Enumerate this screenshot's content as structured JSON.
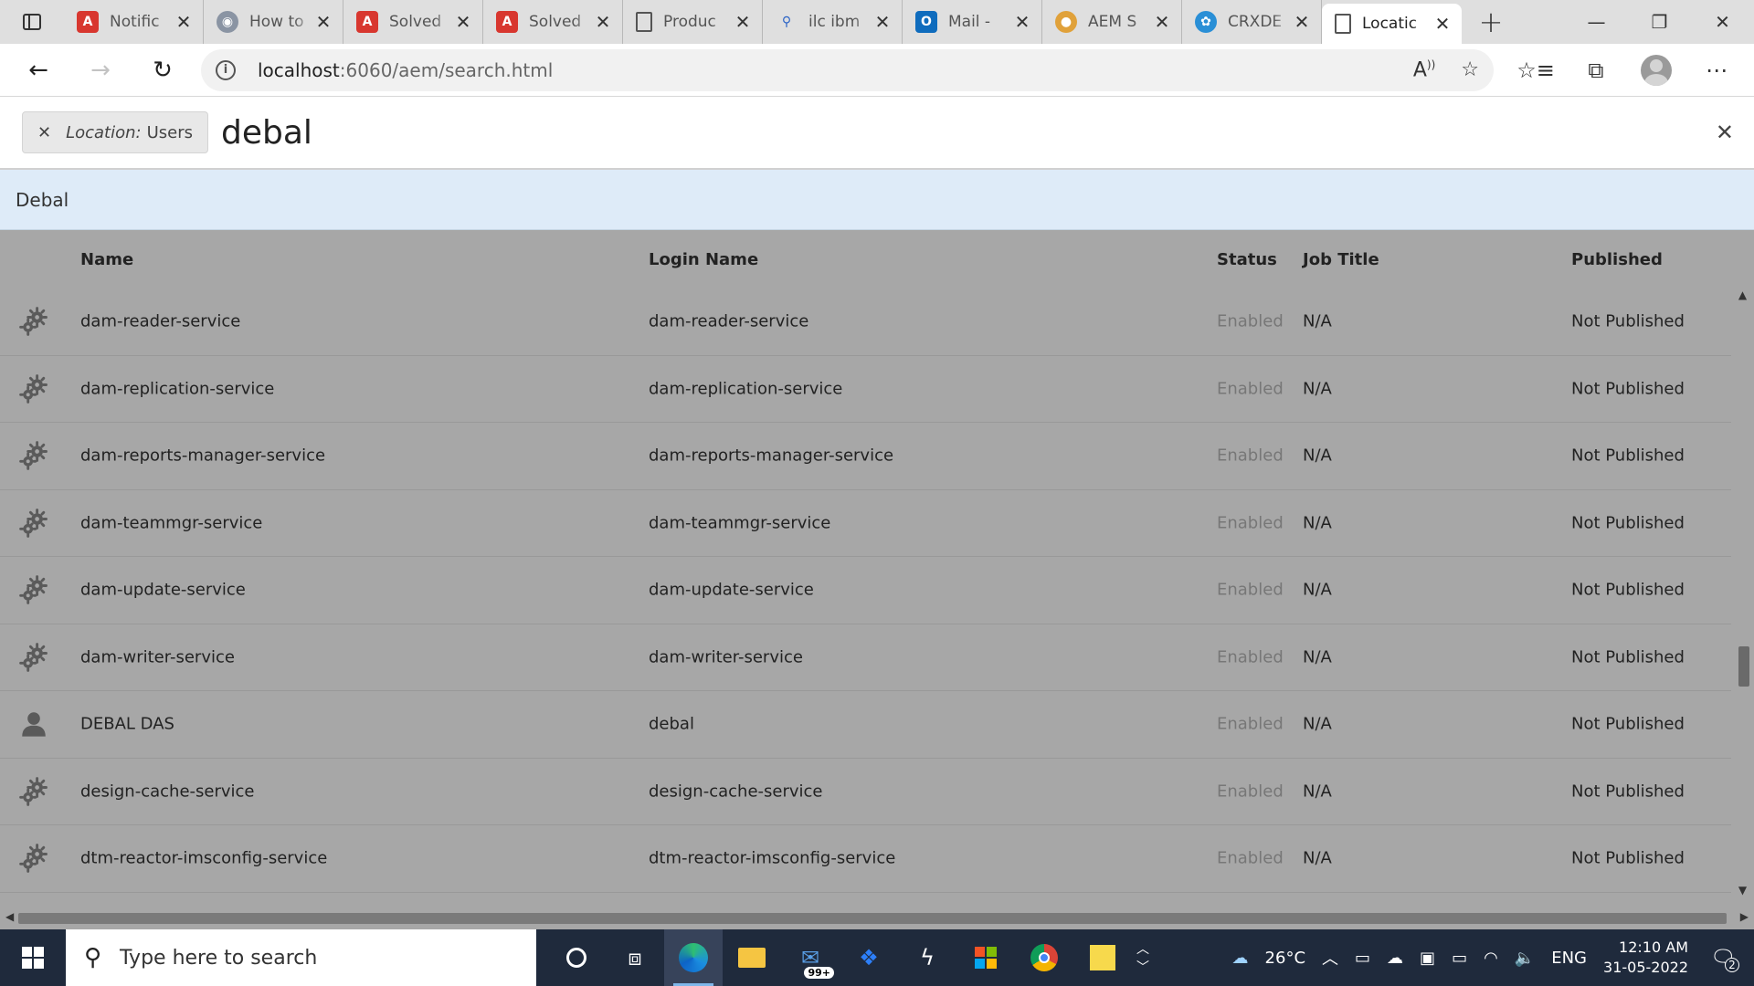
{
  "browser": {
    "tabs": [
      {
        "title": "Notific",
        "icon": "adobe-icon",
        "active": false
      },
      {
        "title": "How to",
        "icon": "globe-icon",
        "active": false
      },
      {
        "title": "Solved",
        "icon": "adobe-icon",
        "active": false
      },
      {
        "title": "Solved",
        "icon": "adobe-icon",
        "active": false
      },
      {
        "title": "Produc",
        "icon": "page-icon",
        "active": false
      },
      {
        "title": "ilc ibm",
        "icon": "search-icon",
        "active": false
      },
      {
        "title": "Mail -",
        "icon": "outlook-icon",
        "active": false
      },
      {
        "title": "AEM S",
        "icon": "people-icon",
        "active": false
      },
      {
        "title": "CRXDE",
        "icon": "crx-icon",
        "active": false
      },
      {
        "title": "Locatic",
        "icon": "page-icon",
        "active": true
      }
    ],
    "url_host": "localhost",
    "url_path": ":6060/aem/search.html"
  },
  "search": {
    "tag_label": "Location:",
    "tag_value": "Users",
    "query": "debal",
    "suggestion": "Debal"
  },
  "table": {
    "columns": {
      "name": "Name",
      "login": "Login Name",
      "status": "Status",
      "job": "Job Title",
      "published": "Published"
    },
    "rows": [
      {
        "type": "service",
        "name": "dam-reader-service",
        "login": "dam-reader-service",
        "status": "Enabled",
        "job": "N/A",
        "published": "Not Published"
      },
      {
        "type": "service",
        "name": "dam-replication-service",
        "login": "dam-replication-service",
        "status": "Enabled",
        "job": "N/A",
        "published": "Not Published"
      },
      {
        "type": "service",
        "name": "dam-reports-manager-service",
        "login": "dam-reports-manager-service",
        "status": "Enabled",
        "job": "N/A",
        "published": "Not Published"
      },
      {
        "type": "service",
        "name": "dam-teammgr-service",
        "login": "dam-teammgr-service",
        "status": "Enabled",
        "job": "N/A",
        "published": "Not Published"
      },
      {
        "type": "service",
        "name": "dam-update-service",
        "login": "dam-update-service",
        "status": "Enabled",
        "job": "N/A",
        "published": "Not Published"
      },
      {
        "type": "service",
        "name": "dam-writer-service",
        "login": "dam-writer-service",
        "status": "Enabled",
        "job": "N/A",
        "published": "Not Published"
      },
      {
        "type": "user",
        "name": "DEBAL DAS",
        "login": "debal",
        "status": "Enabled",
        "job": "N/A",
        "published": "Not Published"
      },
      {
        "type": "service",
        "name": "design-cache-service",
        "login": "design-cache-service",
        "status": "Enabled",
        "job": "N/A",
        "published": "Not Published"
      },
      {
        "type": "service",
        "name": "dtm-reactor-imsconfig-service",
        "login": "dtm-reactor-imsconfig-service",
        "status": "Enabled",
        "job": "N/A",
        "published": "Not Published"
      }
    ]
  },
  "taskbar": {
    "search_placeholder": "Type here to search",
    "mail_badge": "99+",
    "weather": "26°C",
    "language": "ENG",
    "time": "12:10 AM",
    "date": "31-05-2022",
    "notifications": "2"
  }
}
